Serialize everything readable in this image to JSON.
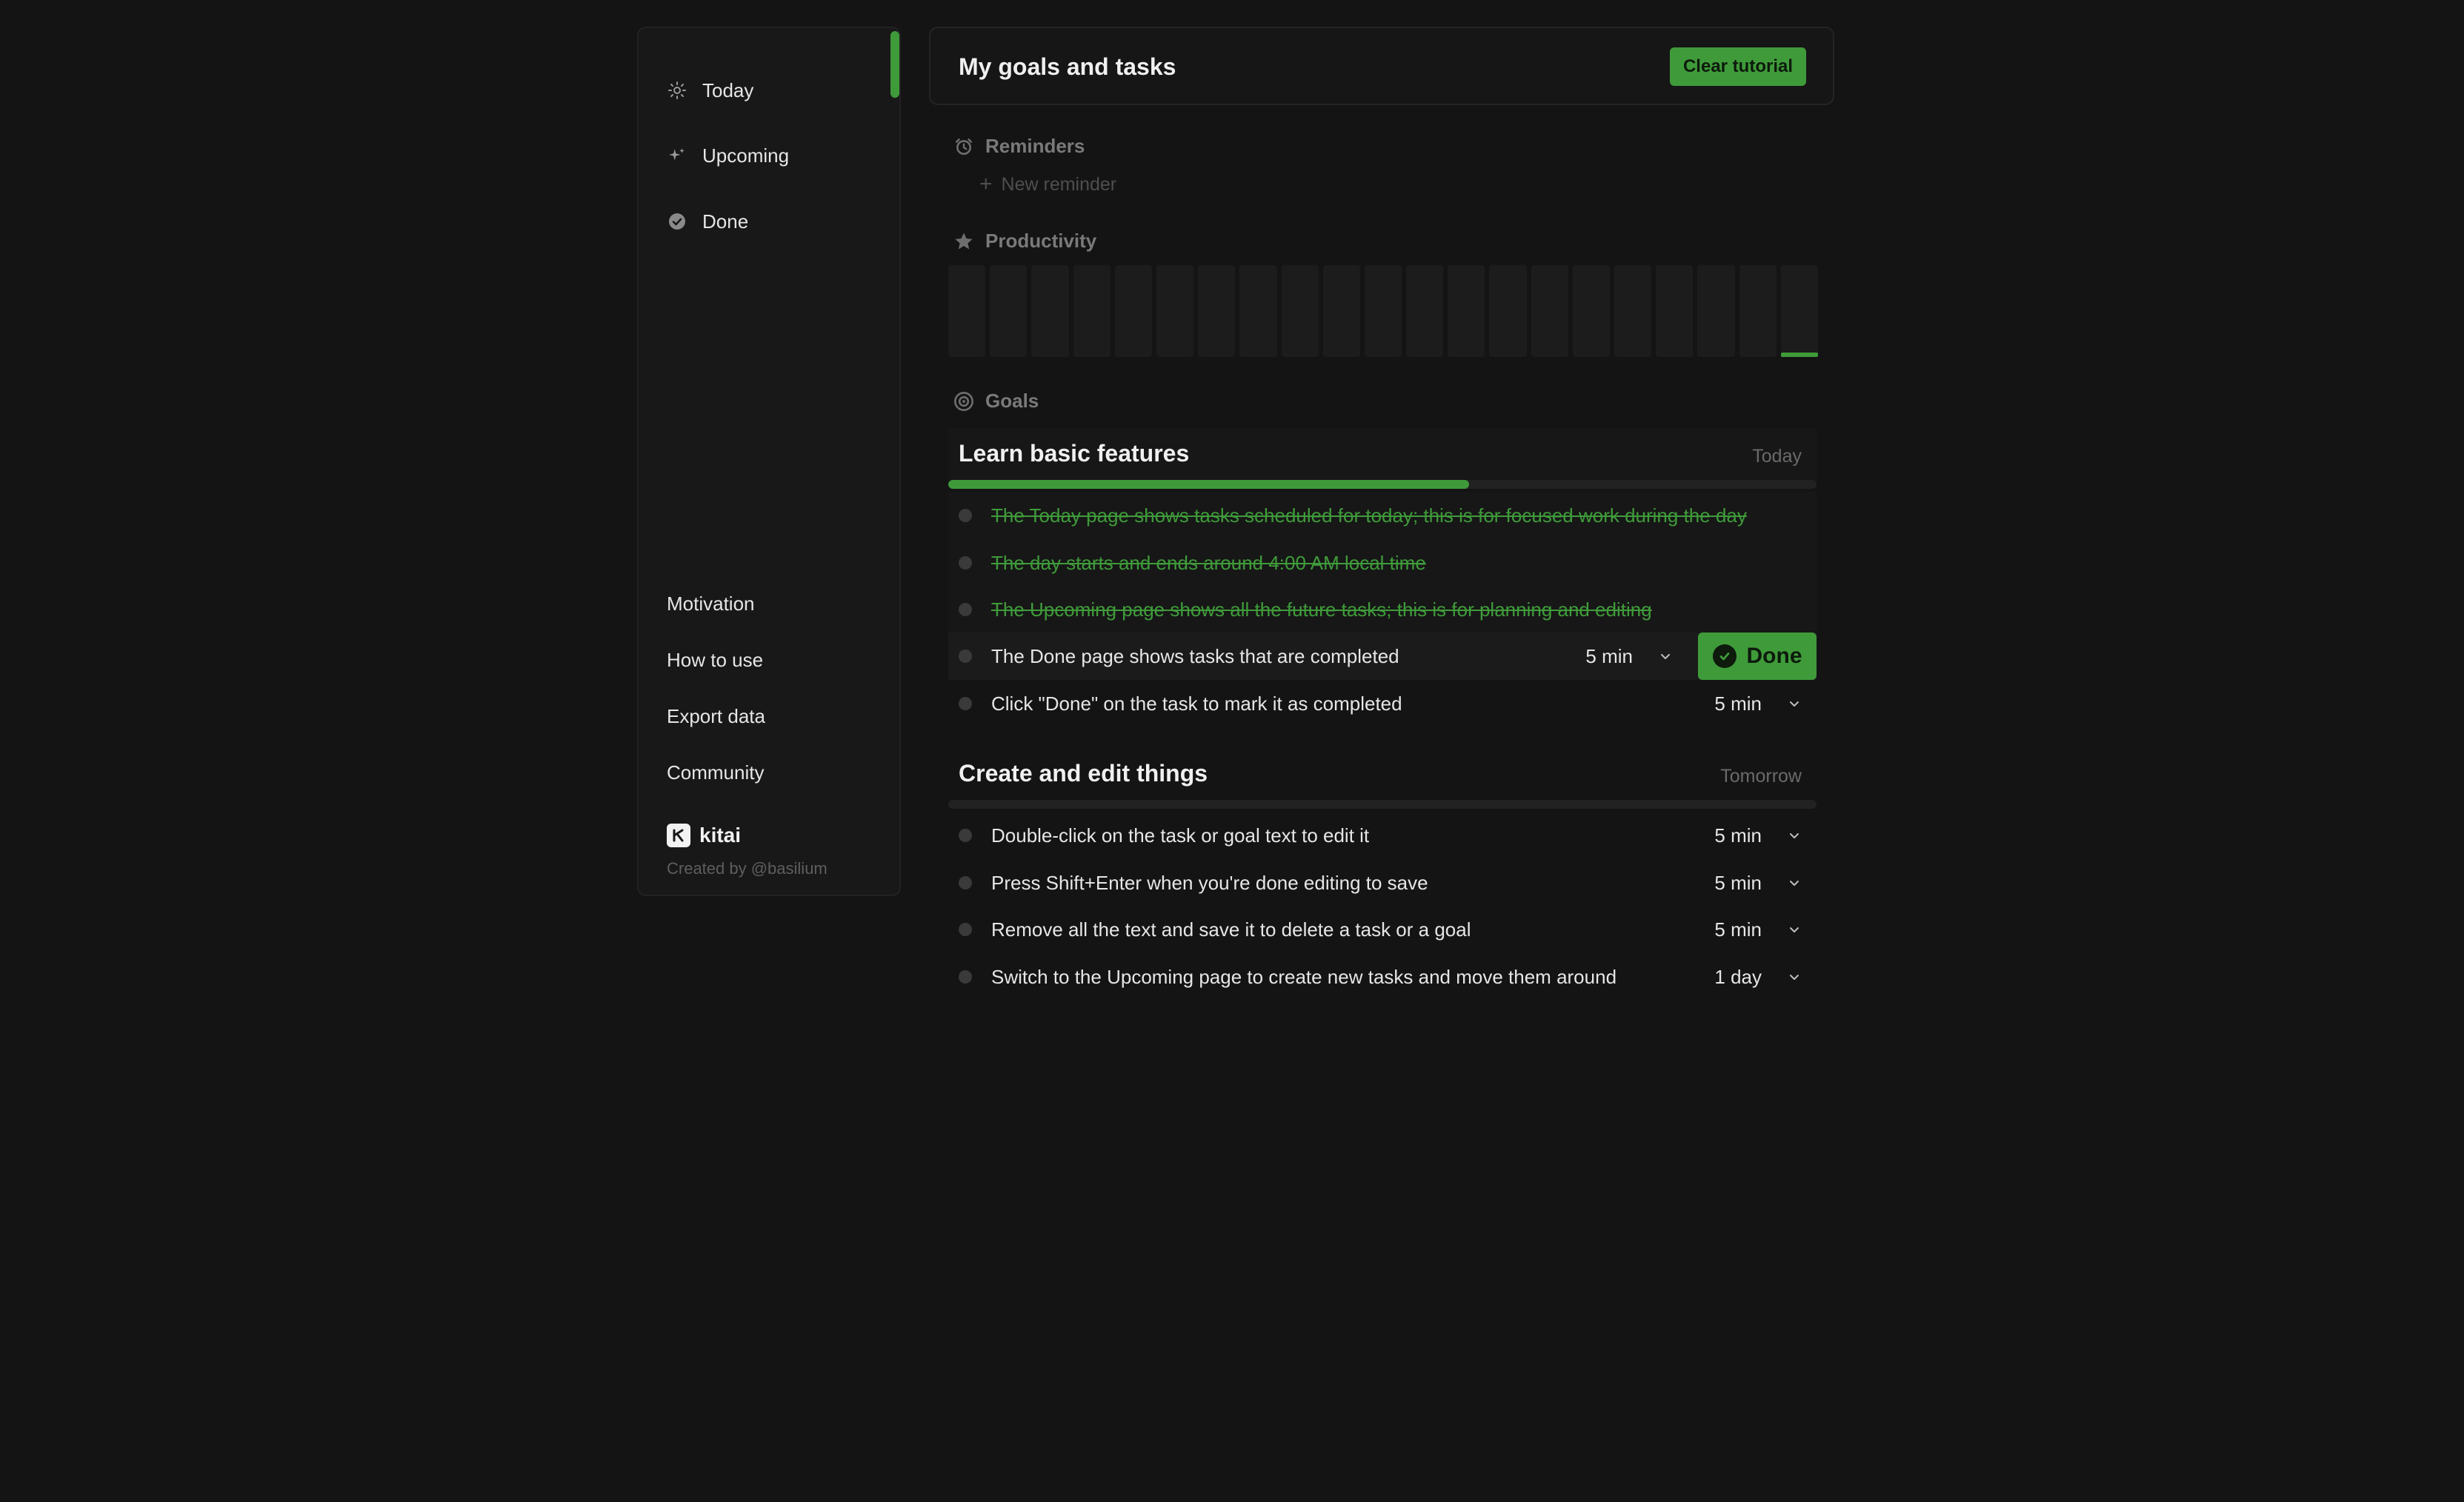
{
  "sidebar": {
    "nav": [
      {
        "label": "Today",
        "icon": "sun-icon"
      },
      {
        "label": "Upcoming",
        "icon": "sparkle-icon"
      },
      {
        "label": "Done",
        "icon": "check-circle-icon"
      }
    ],
    "links": [
      "Motivation",
      "How to use",
      "Export data",
      "Community"
    ],
    "brand": "kitai",
    "credit": "Created by @basilium"
  },
  "header": {
    "title": "My goals and tasks",
    "clear_label": "Clear tutorial"
  },
  "reminders": {
    "label": "Reminders",
    "new_label": "New reminder"
  },
  "productivity": {
    "label": "Productivity",
    "days": 21,
    "levels": [
      0,
      0,
      0,
      0,
      0,
      0,
      0,
      0,
      0,
      0,
      0,
      0,
      0,
      0,
      0,
      0,
      0,
      0,
      0,
      0,
      0.05
    ]
  },
  "goals": {
    "label": "Goals",
    "items": [
      {
        "title": "Learn basic features",
        "when": "Today",
        "progress": 0.6,
        "tasks": [
          {
            "text": "The Today page shows tasks scheduled for today; this is for focused work during the day",
            "done": true,
            "duration": ""
          },
          {
            "text": "The day starts and ends around 4:00 AM local time",
            "done": true,
            "duration": ""
          },
          {
            "text": "The Upcoming page shows all the future tasks; this is for planning and editing",
            "done": true,
            "duration": ""
          },
          {
            "text": "The Done page shows tasks that are completed",
            "done": false,
            "duration": "5 min"
          },
          {
            "text": "Click \"Done\" on the task to mark it as completed",
            "done": false,
            "duration": "5 min"
          }
        ]
      },
      {
        "title": "Create and edit things",
        "when": "Tomorrow",
        "progress": 0,
        "tasks": [
          {
            "text": "Double-click on the task or goal text to edit it",
            "done": false,
            "duration": "5 min"
          },
          {
            "text": "Press Shift+Enter when you're done editing to save",
            "done": false,
            "duration": "5 min"
          },
          {
            "text": "Remove all the text and save it to delete a task or a goal",
            "done": false,
            "duration": "5 min"
          },
          {
            "text": "Switch to the Upcoming page to create new tasks and move them around",
            "done": false,
            "duration": "1 day"
          }
        ]
      }
    ]
  },
  "done_button_label": "Done",
  "colors": {
    "accent": "#3f9b3a",
    "background": "#141414"
  }
}
